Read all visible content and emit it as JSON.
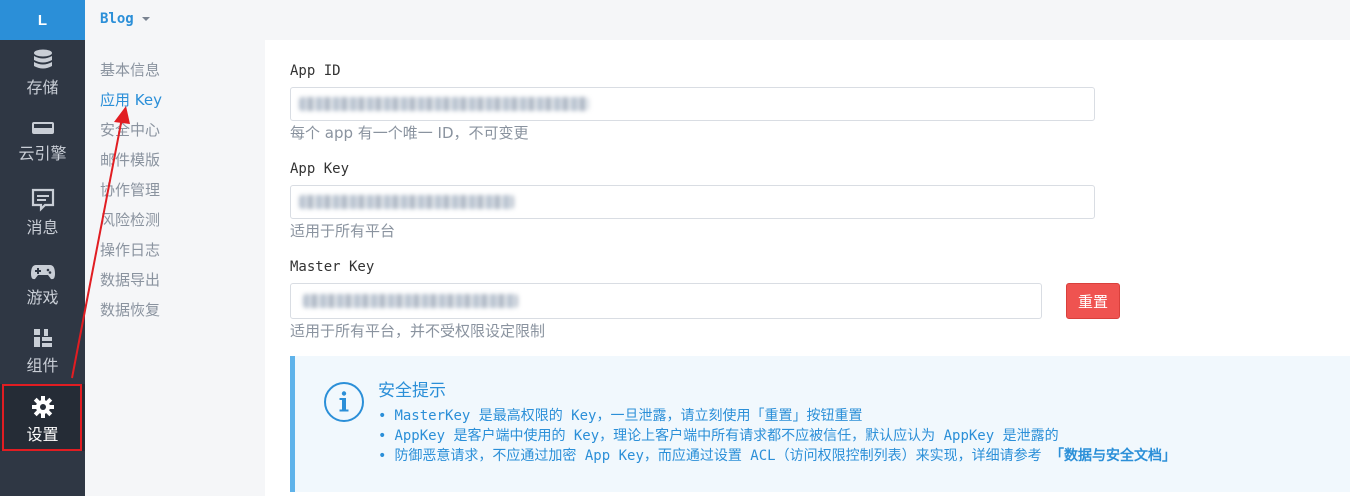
{
  "rail": {
    "logo": "L",
    "items": [
      {
        "label": "存储",
        "icon": "database-icon"
      },
      {
        "label": "云引擎",
        "icon": "server-icon"
      },
      {
        "label": "消息",
        "icon": "message-icon"
      },
      {
        "label": "游戏",
        "icon": "gamepad-icon"
      },
      {
        "label": "组件",
        "icon": "components-icon"
      },
      {
        "label": "设置",
        "icon": "gear-icon",
        "active": true
      }
    ]
  },
  "topbar": {
    "app_name": "Blog"
  },
  "subnav": {
    "items": [
      "基本信息",
      "应用 Key",
      "安全中心",
      "邮件模版",
      "协作管理",
      "风险检测",
      "操作日志",
      "数据导出",
      "数据恢复"
    ],
    "active_index": 1
  },
  "fields": {
    "app_id": {
      "label": "App ID",
      "help": "每个 app 有一个唯一 ID，不可变更"
    },
    "app_key": {
      "label": "App Key",
      "help": "适用于所有平台"
    },
    "master_key": {
      "label": "Master Key",
      "help": "适用于所有平台，并不受权限设定限制",
      "reset_label": "重置"
    }
  },
  "notice": {
    "title": "安全提示",
    "items": [
      "MasterKey 是最高权限的 Key，一旦泄露，请立刻使用「重置」按钮重置",
      "AppKey 是客户端中使用的 Key，理论上客户端中所有请求都不应被信任，默认应认为 AppKey 是泄露的",
      "防御恶意请求，不应通过加密 App Key，而应通过设置 ACL（访问权限控制列表）来实现，详细请参考 "
    ],
    "doc_link": "「数据与安全文档」"
  },
  "colors": {
    "accent": "#2b8fd8",
    "danger": "#ef5350",
    "rail_bg": "#2f3744",
    "highlight": "#e11d22"
  }
}
